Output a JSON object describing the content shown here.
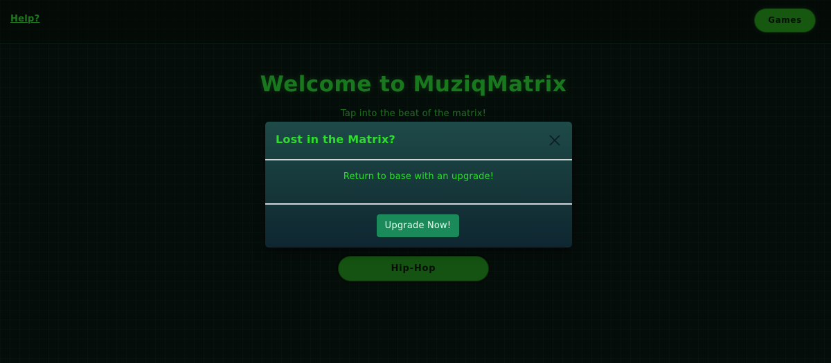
{
  "nav": {
    "help_label": "Help?",
    "games_label": "Games"
  },
  "hero": {
    "title": "Welcome to MuziqMatrix",
    "subtitle": "Tap into the beat of the matrix!"
  },
  "genres": {
    "items": [
      {
        "label": "Hip-Hop"
      }
    ]
  },
  "modal": {
    "title": "Lost in the Matrix?",
    "message": "Return to base with an upgrade!",
    "button_label": "Upgrade Now!",
    "close_icon": "close-icon"
  },
  "colors": {
    "background": "#08130e",
    "accent_green": "#23a62a",
    "modal_text_green": "#2fdc2f",
    "button_green": "#1f7a16",
    "upgrade_button": "#1a8a5a"
  }
}
